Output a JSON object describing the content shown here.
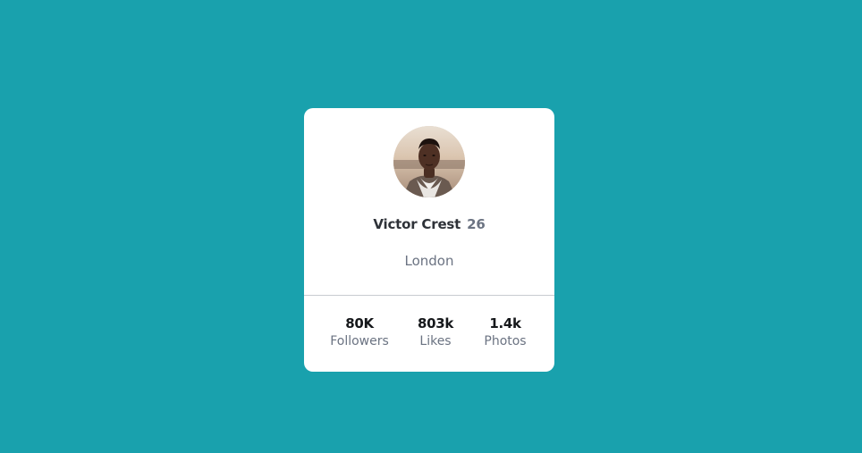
{
  "colors": {
    "background": "#19a1ad",
    "card": "#ffffff",
    "name_text": "#2e3238",
    "muted_text": "#6b7382",
    "divider": "#c8cbd0"
  },
  "profile": {
    "avatar_icon": "user-photo-avatar",
    "name": "Victor Crest",
    "age": "26",
    "location": "London"
  },
  "stats": [
    {
      "value": "80K",
      "label": "Followers"
    },
    {
      "value": "803k",
      "label": "Likes"
    },
    {
      "value": "1.4k",
      "label": "Photos"
    }
  ]
}
